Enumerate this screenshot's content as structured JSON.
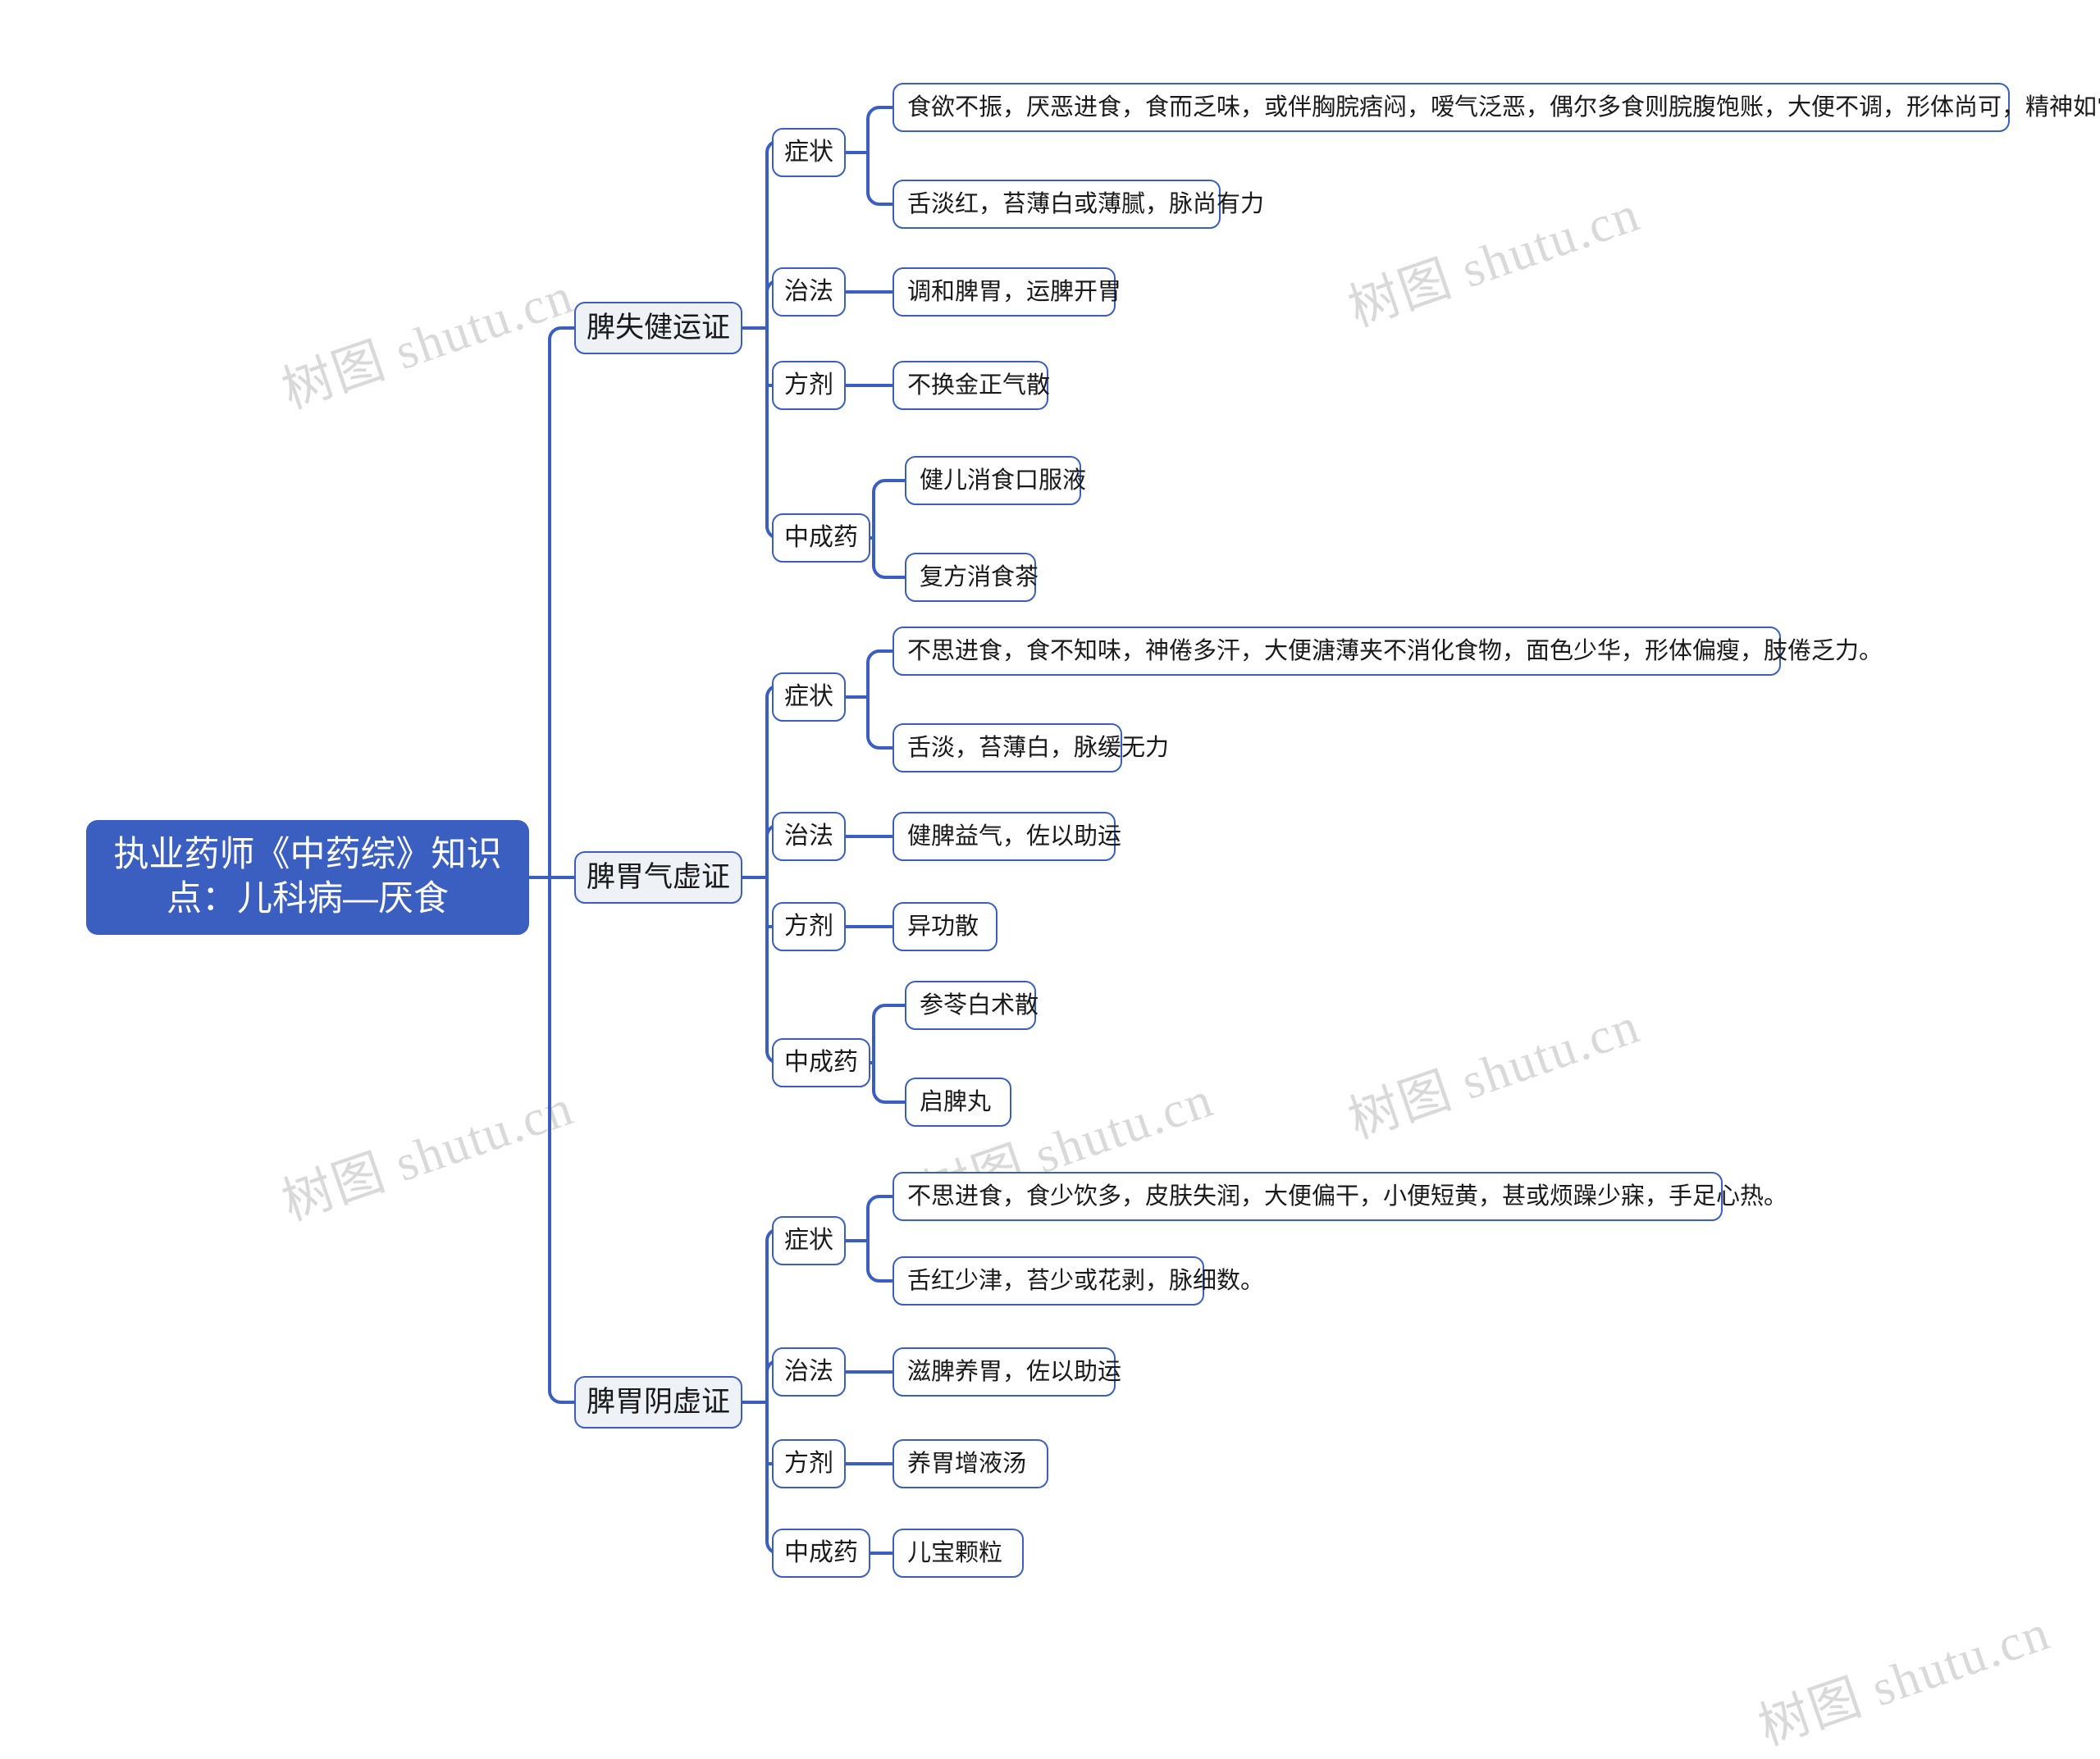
{
  "mindmap": {
    "root": {
      "line1": "执业药师《中药综》知识",
      "line2": "点：儿科病—厌食"
    },
    "branches": [
      {
        "title": "脾失健运证",
        "sections": [
          {
            "label": "症状",
            "items": [
              "食欲不振，厌恶进食，食而乏味，或伴胸脘痞闷，嗳气泛恶，偶尔多食则脘腹饱账，大便不调，形体尚可，精神如常。",
              "舌淡红，苔薄白或薄腻，脉尚有力"
            ]
          },
          {
            "label": "治法",
            "items": [
              "调和脾胃，运脾开胃"
            ]
          },
          {
            "label": "方剂",
            "items": [
              "不换金正气散"
            ]
          },
          {
            "label": "中成药",
            "items": [
              "健儿消食口服液",
              "复方消食茶"
            ]
          }
        ]
      },
      {
        "title": "脾胃气虚证",
        "sections": [
          {
            "label": "症状",
            "items": [
              "不思进食，食不知味，神倦多汗，大便溏薄夹不消化食物，面色少华，形体偏瘦，肢倦乏力。",
              "舌淡，苔薄白，脉缓无力"
            ]
          },
          {
            "label": "治法",
            "items": [
              "健脾益气，佐以助运"
            ]
          },
          {
            "label": "方剂",
            "items": [
              "异功散"
            ]
          },
          {
            "label": "中成药",
            "items": [
              "参苓白术散",
              "启脾丸"
            ]
          }
        ]
      },
      {
        "title": "脾胃阴虚证",
        "sections": [
          {
            "label": "症状",
            "items": [
              "不思进食，食少饮多，皮肤失润，大便偏干，小便短黄，甚或烦躁少寐，手足心热。",
              "舌红少津，苔少或花剥，脉细数。"
            ]
          },
          {
            "label": "治法",
            "items": [
              "滋脾养胃，佐以助运"
            ]
          },
          {
            "label": "方剂",
            "items": [
              "养胃增液汤"
            ]
          },
          {
            "label": "中成药",
            "items": [
              "儿宝颗粒"
            ]
          }
        ]
      }
    ]
  },
  "watermarks": [
    "树图 shutu.cn",
    "树图 shutu.cn",
    "树图 shutu.cn",
    "树图 shutu.cn",
    "树图 shutu.cn",
    "树图 shutu.cn"
  ],
  "colors": {
    "accent": "#3b5fc0",
    "root_text": "#ffffff",
    "node_fill": "#ffffff",
    "lvl2_fill": "#eef1f6",
    "watermark": "#d9d9d9"
  }
}
